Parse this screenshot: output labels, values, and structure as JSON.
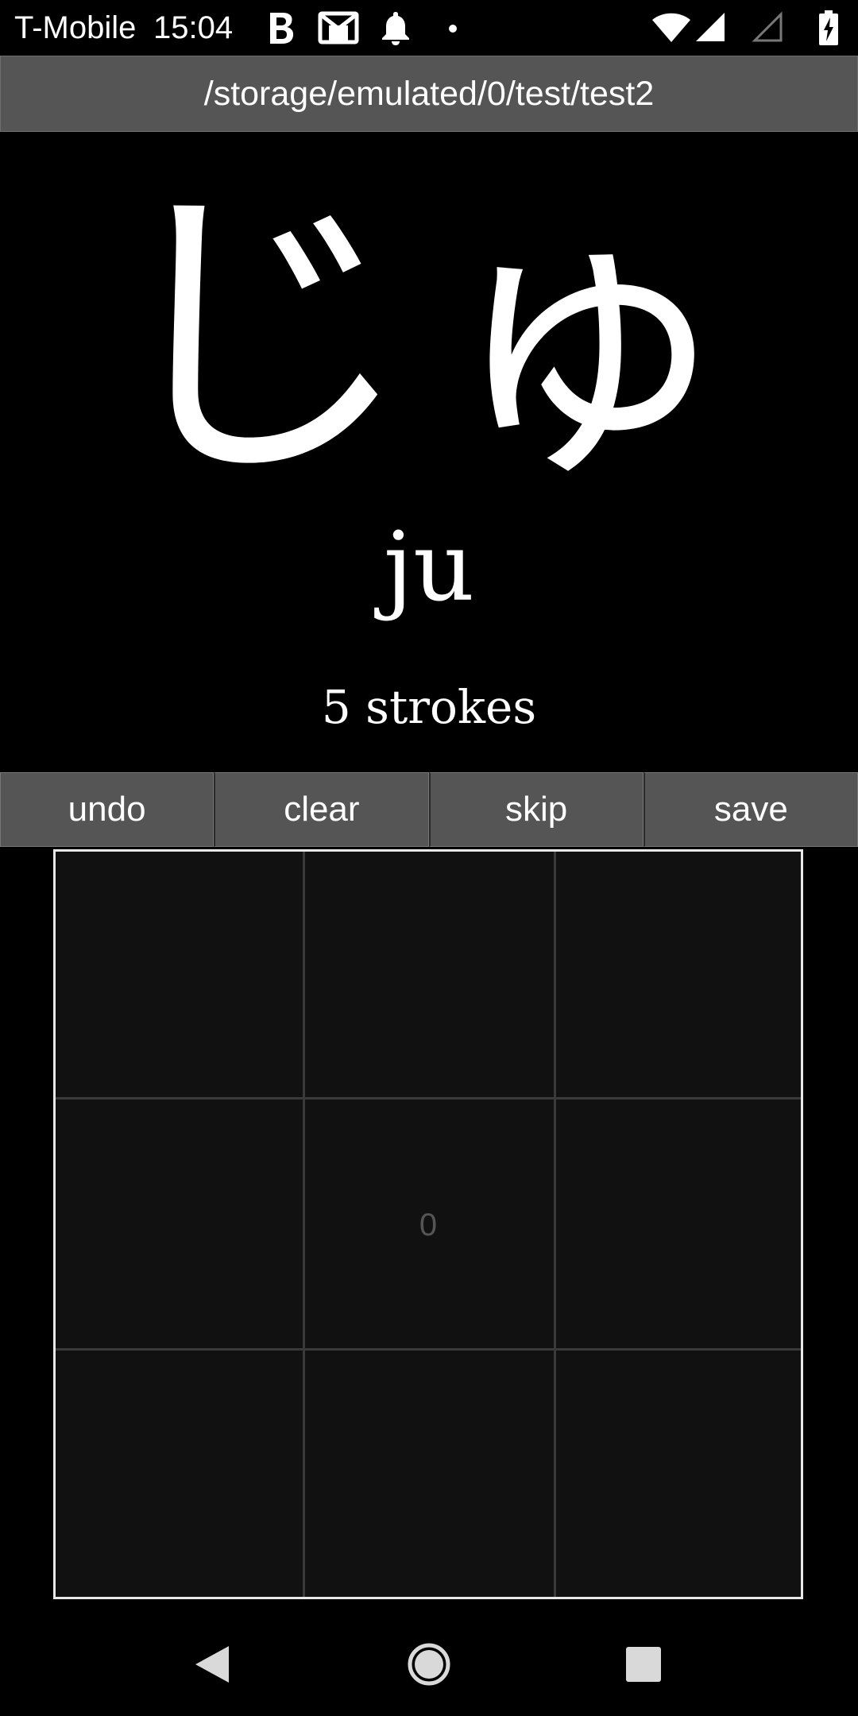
{
  "status_bar": {
    "carrier": "T-Mobile",
    "time": "15:04",
    "icons": [
      "bold-b-icon",
      "gmail-icon",
      "notification-bell-icon",
      "dot-icon",
      "wifi-icon",
      "signal-icon",
      "signal-empty-icon",
      "battery-charging-icon"
    ]
  },
  "path_bar": {
    "path": "/storage/emulated/0/test/test2"
  },
  "character": {
    "kana": "じゅ",
    "romaji": "ju",
    "strokes_text": "5 strokes"
  },
  "toolbar": {
    "undo_label": "undo",
    "clear_label": "clear",
    "skip_label": "skip",
    "save_label": "save"
  },
  "drawing_pad": {
    "stroke_count": "0"
  },
  "nav_bar": {
    "icons": [
      "back-icon",
      "home-icon",
      "recents-icon"
    ]
  }
}
